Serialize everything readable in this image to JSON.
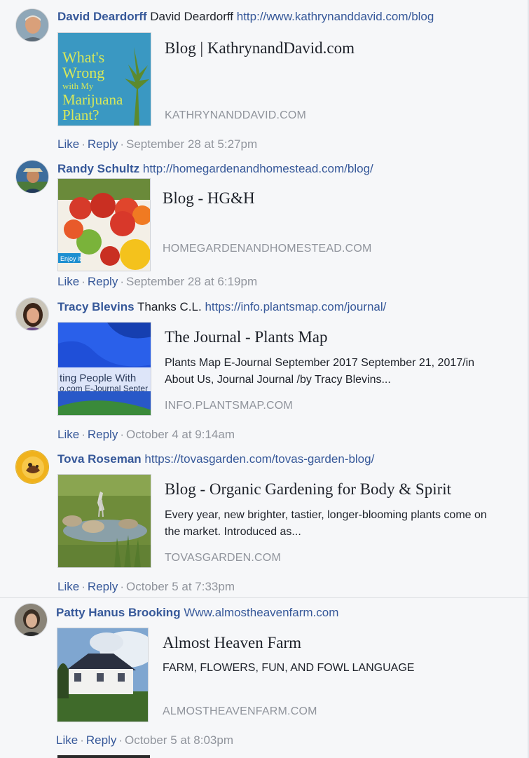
{
  "comments": [
    {
      "author": "David Deardorff",
      "text": "David Deardorff",
      "link": "http://www.kathrynanddavid.com/blog",
      "card": {
        "title": "Blog | KathrynandDavid.com",
        "description": "",
        "domain": "KATHRYNANDDAVID.COM",
        "image_text": [
          "What's",
          "Wrong",
          "with My",
          "Marijuana",
          "Plant?"
        ]
      },
      "actions": {
        "like": "Like",
        "reply": "Reply",
        "timestamp": "September 28 at 5:27pm"
      }
    },
    {
      "author": "Randy Schultz",
      "text": "",
      "link": "http://homegardenandhomestead.com/blog/",
      "card": {
        "title": "Blog - HG&H",
        "description": "",
        "domain": "HOMEGARDENANDHOMESTEAD.COM",
        "image_text": [
          "Enjoy it"
        ]
      },
      "actions": {
        "like": "Like",
        "reply": "Reply",
        "timestamp": "September 28 at 6:19pm"
      }
    },
    {
      "author": "Tracy Blevins",
      "text": "Thanks C.L.",
      "link": "https://info.plantsmap.com/journal/",
      "card": {
        "title": "The Journal - Plants Map",
        "description": "Plants Map E-Journal September 2017 September 21, 2017/in About Us, Journal Journal /by Tracy Blevins...",
        "domain": "INFO.PLANTSMAP.COM",
        "image_text": [
          "ting People With",
          "o.com E-Journal Septer"
        ]
      },
      "actions": {
        "like": "Like",
        "reply": "Reply",
        "timestamp": "October 4 at 9:14am"
      }
    },
    {
      "author": "Tova Roseman",
      "text": "",
      "link": "https://tovasgarden.com/tovas-garden-blog/",
      "card": {
        "title": "Blog - Organic Gardening for Body & Spirit",
        "description": "Every year, new brighter, tastier, longer-blooming plants come on the market. Introduced as...",
        "domain": "TOVASGARDEN.COM",
        "image_text": []
      },
      "actions": {
        "like": "Like",
        "reply": "Reply",
        "timestamp": "October 5 at 7:33pm"
      }
    },
    {
      "author": "Patty Hanus Brooking",
      "text": "",
      "link": "Www.almostheavenfarm.com",
      "card": {
        "title": "Almost Heaven Farm",
        "description": "FARM, FLOWERS, FUN, AND FOWL LANGUAGE",
        "domain": "ALMOSTHEAVENFARM.COM",
        "image_text": []
      },
      "actions": {
        "like": "Like",
        "reply": "Reply",
        "timestamp": "October 5 at 8:03pm"
      }
    }
  ],
  "colors": {
    "link": "#365899",
    "meta": "#90949c",
    "background": "#f6f7f9"
  }
}
